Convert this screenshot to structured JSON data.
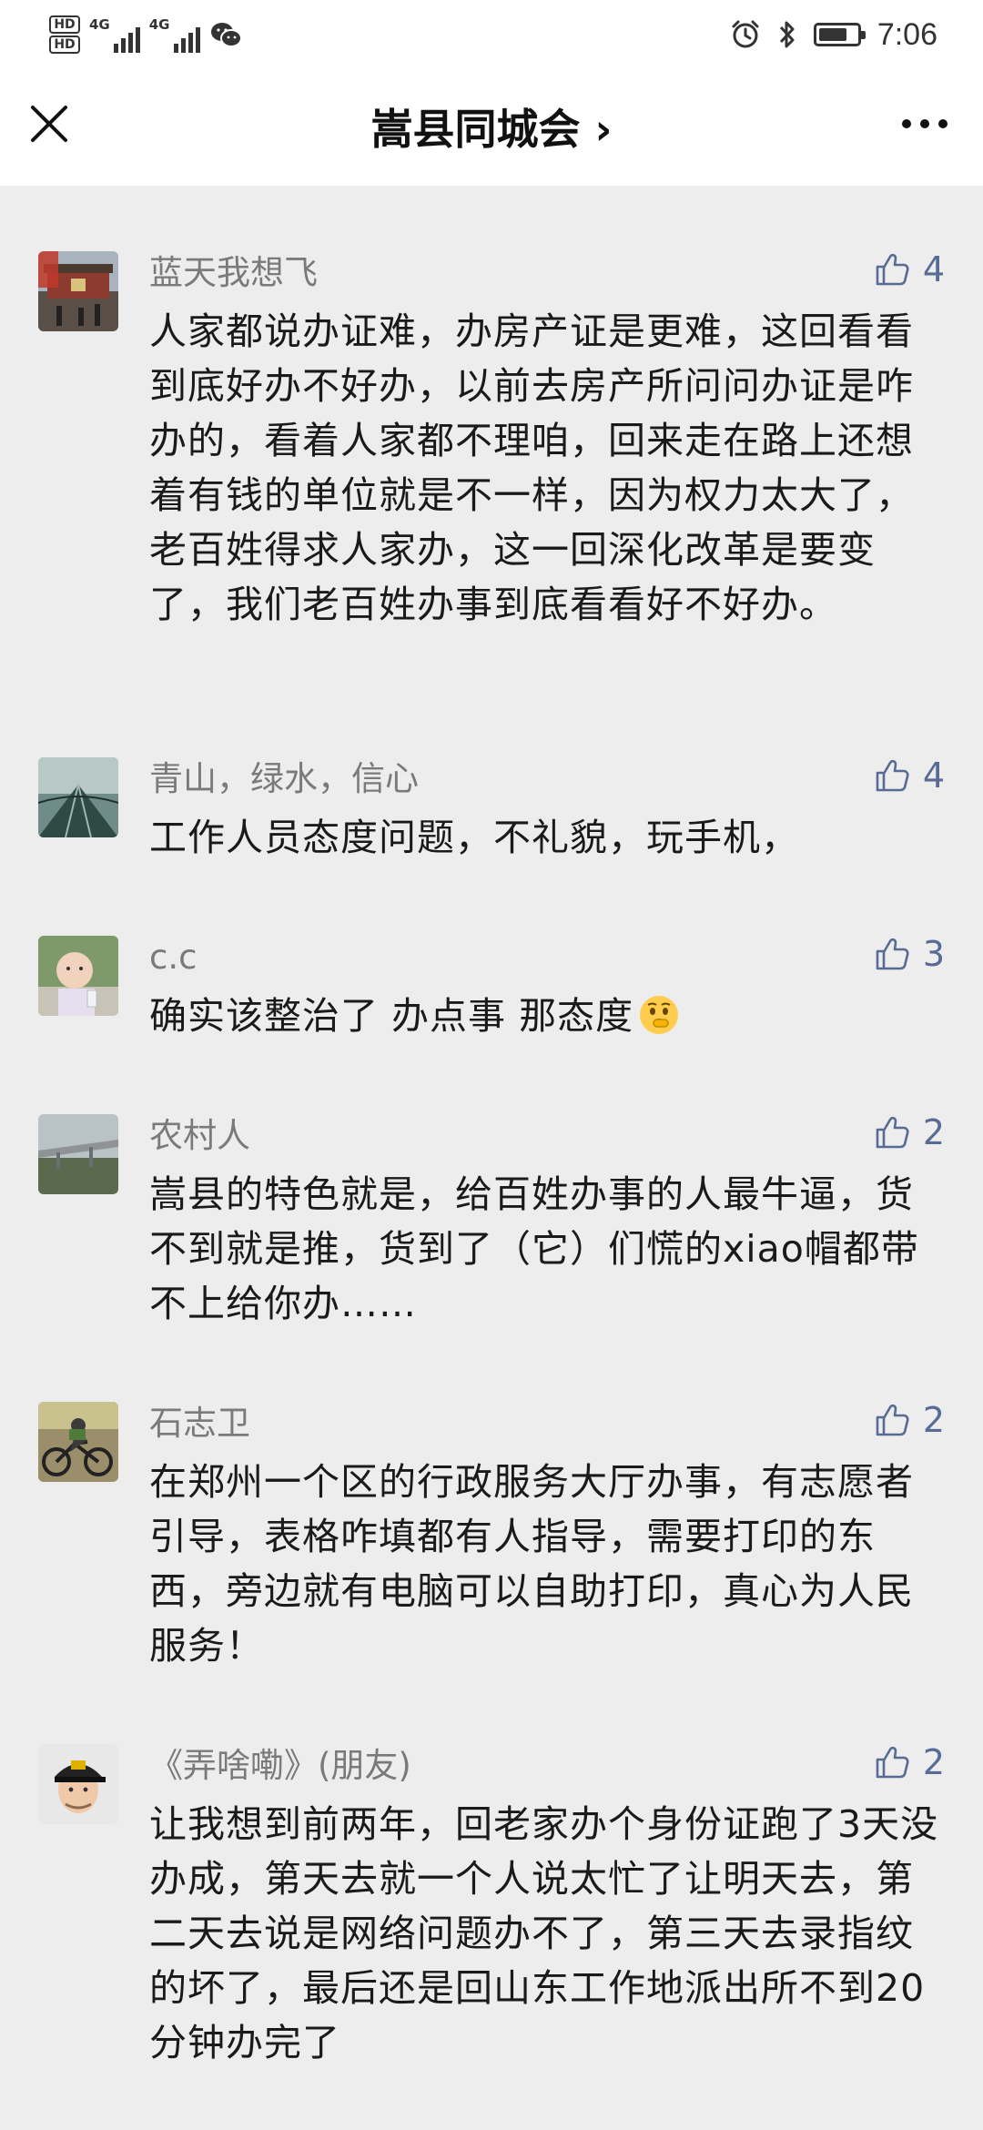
{
  "status_bar": {
    "hd1": "HD",
    "hd2": "HD",
    "net1": "4G",
    "net2": "4G",
    "time": "7:06",
    "battery_level": 0.75,
    "icons": [
      "wechat-icon",
      "alarm-icon",
      "bluetooth-icon",
      "battery-icon"
    ]
  },
  "header": {
    "title": "嵩县同城会 ›",
    "close_icon": "close-icon",
    "more_icon": "more-dots-icon"
  },
  "colors": {
    "page_bg": "#ededed",
    "header_bg": "#ffffff",
    "name_gray": "#7a7a7a",
    "text_dark": "#1a1a1a",
    "like_blue": "#576b95"
  },
  "comments": [
    {
      "name": "蓝天我想飞",
      "likes": "4",
      "text": "人家都说办证难，办房产证是更难，这回看看到底好办不好办，以前去房产所问问办证是咋办的，看着人家都不理咱，回来走在路上还想着有钱的单位就是不一样，因为权力太大了，老百姓得求人家办，这一回深化改革是要变了，我们老百姓办事到底看看好不好办。"
    },
    {
      "name": "青山，绿水，信心",
      "likes": "4",
      "text": "工作人员态度问题，不礼貌，玩手机，"
    },
    {
      "name": "c.c",
      "likes": "3",
      "text": "确实该整治了 办点事 那态度",
      "emoji": "shushing-face-emoji"
    },
    {
      "name": "农村人",
      "likes": "2",
      "text": "嵩县的特色就是，给百姓办事的人最牛逼，货不到就是推，货到了（它）们慌的xiao帽都带不上给你办……"
    },
    {
      "name": "石志卫",
      "likes": "2",
      "text": "在郑州一个区的行政服务大厅办事，有志愿者引导，表格咋填都有人指导，需要打印的东西，旁边就有电脑可以自助打印，真心为人民服务！"
    },
    {
      "name": "《弄啥嘞》(朋友)",
      "likes": "2",
      "text": "让我想到前两年，回老家办个身份证跑了3天没办成，第天去就一个人说太忙了让明天去，第二天去说是网络问题办不了，第三天去录指纹的坏了，最后还是回山东工作地派出所不到20分钟办完了"
    }
  ]
}
